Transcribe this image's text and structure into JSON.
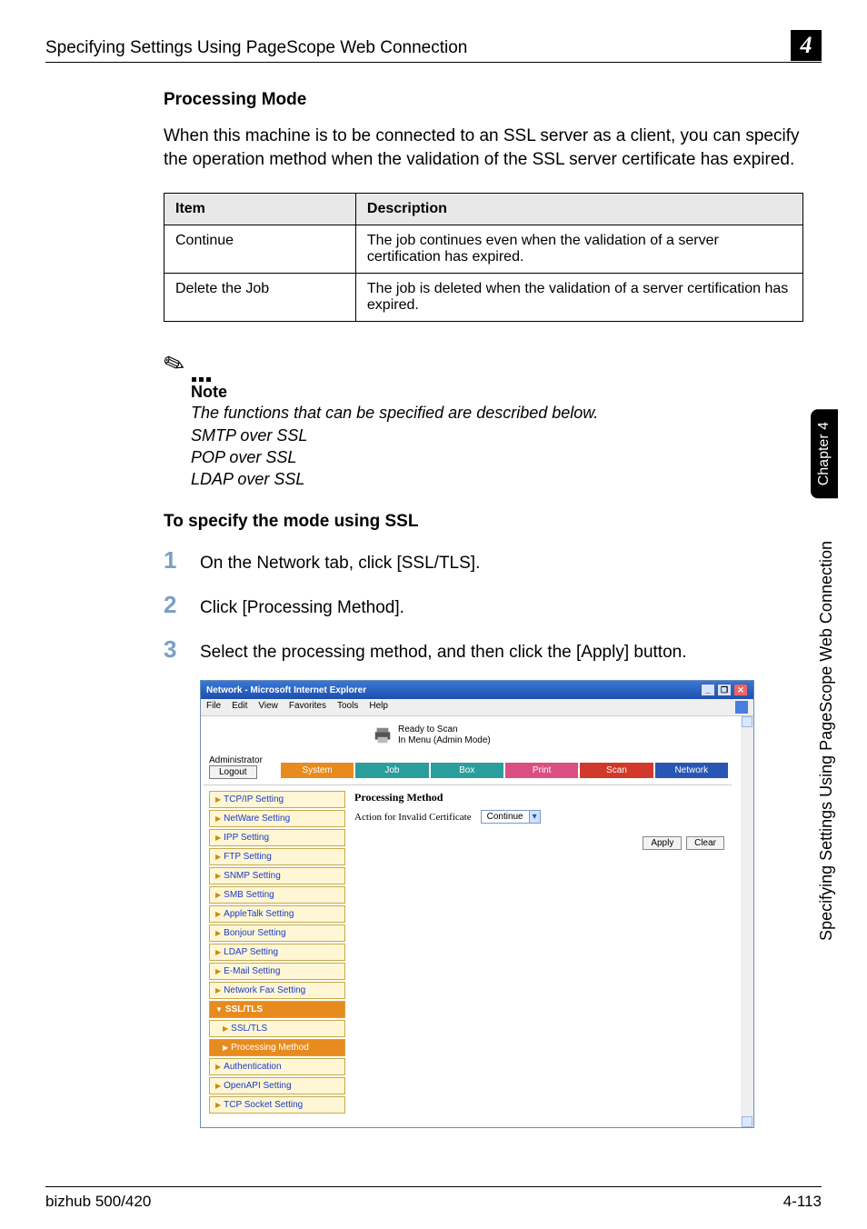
{
  "header": {
    "running_head": "Specifying Settings Using PageScope Web Connection",
    "chapter_number": "4"
  },
  "section": {
    "title": "Processing Mode",
    "intro": "When this machine is to be connected to an SSL server as a client, you can specify the operation method when the validation of the SSL server certificate has expired."
  },
  "table": {
    "headers": {
      "item": "Item",
      "desc": "Description"
    },
    "rows": [
      {
        "item": "Continue",
        "desc": "The job continues even when the validation of a server certification has expired."
      },
      {
        "item": "Delete the Job",
        "desc": "The job is deleted when the validation of a server certification has expired."
      }
    ]
  },
  "note": {
    "label": "Note",
    "line1": "The functions that can be specified are described below.",
    "line2": "SMTP over SSL",
    "line3": "POP over SSL",
    "line4": "LDAP over SSL"
  },
  "subheading": "To specify the mode using SSL",
  "steps": [
    "On the Network tab, click [SSL/TLS].",
    "Click [Processing Method].",
    "Select the processing method, and then click the [Apply] button."
  ],
  "browser": {
    "title": "Network - Microsoft Internet Explorer",
    "menus": [
      "File",
      "Edit",
      "View",
      "Favorites",
      "Tools",
      "Help"
    ],
    "status1": "Ready to Scan",
    "status2": "In Menu (Admin Mode)",
    "admin_label": "Administrator",
    "logout": "Logout",
    "tabs": {
      "system": "System",
      "job": "Job",
      "box": "Box",
      "print": "Print",
      "scan": "Scan",
      "network": "Network"
    },
    "sidebar": [
      "TCP/IP Setting",
      "NetWare Setting",
      "IPP Setting",
      "FTP Setting",
      "SNMP Setting",
      "SMB Setting",
      "AppleTalk Setting",
      "Bonjour Setting",
      "LDAP Setting",
      "E-Mail Setting",
      "Network Fax Setting"
    ],
    "ssl_section_label": "SSL/TLS",
    "ssl_sub1": "SSL/TLS",
    "ssl_sub2": "Processing Method",
    "sidebar_after": [
      "Authentication",
      "OpenAPI Setting",
      "TCP Socket Setting"
    ],
    "panel": {
      "heading": "Processing Method",
      "field_label": "Action for Invalid Certificate",
      "dropdown_value": "Continue",
      "apply": "Apply",
      "clear": "Clear"
    }
  },
  "side": {
    "tab_label": "Chapter 4",
    "vtext": "Specifying Settings Using PageScope Web Connection"
  },
  "footer": {
    "left": "bizhub 500/420",
    "right": "4-113"
  }
}
